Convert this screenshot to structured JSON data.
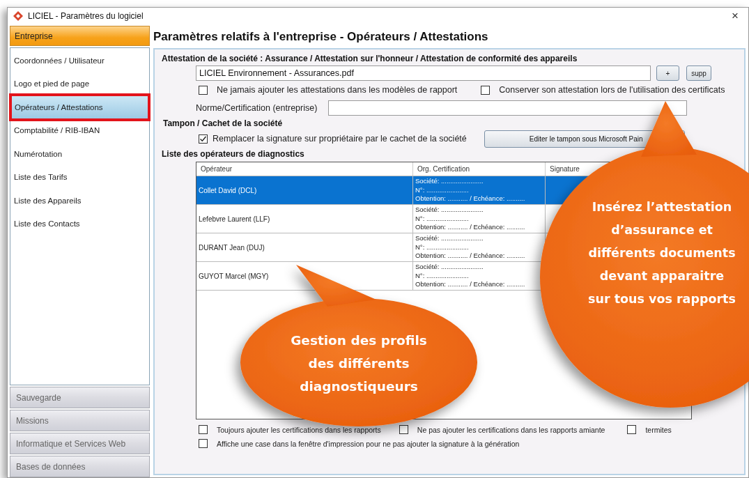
{
  "window": {
    "title": "LICIEL - Paramètres du logiciel",
    "close": "×"
  },
  "sidebar": {
    "header": "Entreprise",
    "items": [
      {
        "label": "Coordonnées / Utilisateur",
        "selected": false
      },
      {
        "label": "Logo et pied de page",
        "selected": false
      },
      {
        "label": "Opérateurs / Attestations",
        "selected": true
      },
      {
        "label": "Comptabilité / RIB-IBAN",
        "selected": false
      },
      {
        "label": "Numérotation",
        "selected": false
      },
      {
        "label": "Liste des Tarifs",
        "selected": false
      },
      {
        "label": "Liste des Appareils",
        "selected": false
      },
      {
        "label": "Liste des Contacts",
        "selected": false
      }
    ],
    "sections": [
      "Sauvegarde",
      "Missions",
      "Informatique et Services Web",
      "Bases de données"
    ]
  },
  "page_title": "Paramètres relatifs à l'entreprise - Opérateurs / Attestations",
  "attestation": {
    "heading": "Attestation de la société : Assurance / Attestation sur l'honneur / Attestation de conformité des appareils",
    "file_value": "LICIEL Environnement -  Assurances.pdf",
    "buttons": [
      "+",
      "supp"
    ],
    "checkboxes": [
      {
        "label": "Ne jamais ajouter les attestations dans les modèles de rapport",
        "checked": false
      },
      {
        "label": "Conserver son attestation lors de l'utilisation des certificats",
        "checked": false
      }
    ],
    "norme_label": "Norme/Certification (entreprise)"
  },
  "tampon": {
    "heading": "Tampon / Cachet de la société",
    "checkbox": {
      "label": "Remplacer la signature sur propriétaire par le cachet de la société",
      "checked": true
    },
    "button": "Editer le tampon sous Microsoft Pain"
  },
  "operators": {
    "heading": "Liste des opérateurs de diagnostics",
    "columns": [
      "Opérateur",
      "Org. Certification",
      "Signature"
    ],
    "rows": [
      {
        "name": "Collet David (DCL)",
        "selected": true,
        "cert": [
          "Société: .......................",
          "N°: .......................",
          "Obtention: ........... / Echéance: .........."
        ]
      },
      {
        "name": "Lefebvre Laurent (LLF)",
        "selected": false,
        "cert": [
          "Société: .......................",
          "N°: .......................",
          "Obtention: ........... / Echéance: .........."
        ]
      },
      {
        "name": "DURANT Jean (DUJ)",
        "selected": false,
        "cert": [
          "Société: .......................",
          "N°: .......................",
          "Obtention: ........... / Echéance: .........."
        ]
      },
      {
        "name": "GUYOT Marcel (MGY)",
        "selected": false,
        "cert": [
          "Société: .......................",
          "N°: .......................",
          "Obtention: ........... / Echéance: .........."
        ]
      }
    ]
  },
  "options": [
    [
      {
        "label": "Toujours ajouter les certifications dans les rapports",
        "checked": false
      },
      {
        "label": "Ne pas ajouter les certifications dans les rapports amiante",
        "checked": false
      },
      {
        "label": "termites",
        "checked": false
      }
    ],
    [
      {
        "label": "Affiche une case dans la fenêtre d'impression pour ne pas ajouter la signature à la génération",
        "checked": false
      }
    ]
  ],
  "callouts": [
    "Gestion des profils des différents diagnostiqueurs",
    "Insérez l’attestation d’assurance et différents documents devant apparaitre sur tous vos rapports"
  ]
}
